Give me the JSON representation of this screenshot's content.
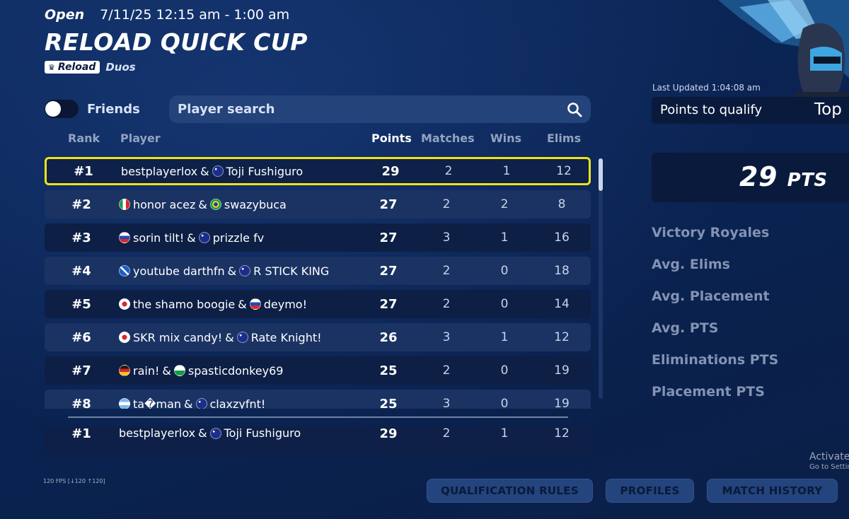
{
  "event": {
    "status": "Open",
    "time_range": "7/11/25 12:15 am - 1:00 am",
    "title": "RELOAD QUICK CUP",
    "mode_tag": "Reload",
    "team_size": "Duos"
  },
  "filters": {
    "friends_label": "Friends",
    "friends_toggle_on": false,
    "search_placeholder": "Player search"
  },
  "table": {
    "columns": {
      "rank": "Rank",
      "player": "Player",
      "points": "Points",
      "matches": "Matches",
      "wins": "Wins",
      "elims": "Elims"
    },
    "rows": [
      {
        "rank": "#1",
        "p1": "bestplayerlox",
        "f1": "",
        "p2": "Toji Fushiguro ￼",
        "f2": "au",
        "points": "29",
        "matches": "2",
        "wins": "1",
        "elims": "12"
      },
      {
        "rank": "#2",
        "p1": "honor acez",
        "f1": "it",
        "p2": "swazybuca",
        "f2": "br",
        "points": "27",
        "matches": "2",
        "wins": "2",
        "elims": "8"
      },
      {
        "rank": "#3",
        "p1": "sorin tilt!",
        "f1": "ru",
        "p2": "prizzle fv",
        "f2": "au",
        "points": "27",
        "matches": "3",
        "wins": "1",
        "elims": "16"
      },
      {
        "rank": "#4",
        "p1": "youtube darthfn",
        "f1": "sc",
        "p2": "R STICK KING",
        "f2": "au",
        "points": "27",
        "matches": "2",
        "wins": "0",
        "elims": "18"
      },
      {
        "rank": "#5",
        "p1": "the shamo boogie",
        "f1": "jp",
        "p2": "deymo!",
        "f2": "ru",
        "points": "27",
        "matches": "2",
        "wins": "0",
        "elims": "14"
      },
      {
        "rank": "#6",
        "p1": "SKR mix candy!",
        "f1": "jp",
        "p2": "Rate Knight!",
        "f2": "au",
        "points": "26",
        "matches": "3",
        "wins": "1",
        "elims": "12"
      },
      {
        "rank": "#7",
        "p1": "rain!",
        "f1": "de",
        "p2": "spasticdonkey69",
        "f2": "wl",
        "points": "25",
        "matches": "2",
        "wins": "0",
        "elims": "19"
      },
      {
        "rank": "#8",
        "p1": "ta�man",
        "f1": "ar",
        "p2": "claxzyfnt!",
        "f2": "au",
        "points": "25",
        "matches": "3",
        "wins": "0",
        "elims": "19"
      }
    ],
    "my_row": {
      "rank": "#1",
      "p1": "bestplayerlox",
      "f1": "",
      "p2": "Toji Fushiguro ￼",
      "f2": "au",
      "points": "29",
      "matches": "2",
      "wins": "1",
      "elims": "12"
    }
  },
  "side_panel": {
    "last_updated": "Last Updated 1:04:08 am",
    "qualify_label": "Points to qualify",
    "qualify_value": "Top",
    "points_value": "29",
    "points_unit": "PTS",
    "stats": [
      "Victory Royales",
      "Avg. Elims",
      "Avg. Placement",
      "Avg. PTS",
      "Eliminations PTS",
      "Placement PTS"
    ]
  },
  "footer": {
    "fps": "120 FPS [↓120 ↑120]",
    "buttons": [
      "QUALIFICATION RULES",
      "PROFILES",
      "MATCH HISTORY"
    ]
  },
  "watermark": {
    "line1": "Activate",
    "line2": "Go to Settin"
  },
  "colors": {
    "highlight_border": "#f0e21a",
    "background": "#0a2352",
    "button_bg": "#23447d"
  }
}
